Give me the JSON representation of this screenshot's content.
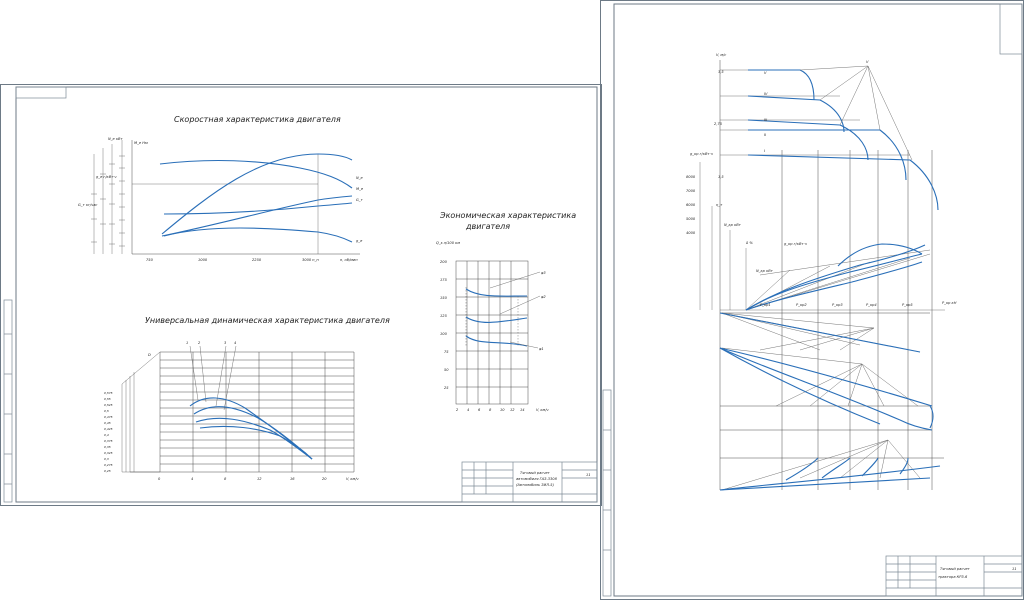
{
  "sheet1": {
    "speed_chart": {
      "title": "Скоростная характеристика двигателя",
      "axis_labels": [
        "N_e кВт",
        "M_e Нм",
        "g_e г/кВт·ч",
        "G_т кг/час",
        "n, об/мин"
      ],
      "x_ticks": [
        "750",
        "1000",
        "2250",
        "3000 n_н",
        "3750"
      ],
      "series_labels": [
        "N_e",
        "M_e",
        "G_т",
        "g_e"
      ]
    },
    "economic_chart": {
      "title_line1": "Экономическая характеристика",
      "title_line2": "двигателя",
      "y_label": "Q_s л/100 км",
      "y_ticks": [
        "200",
        "175",
        "150",
        "125",
        "100",
        "75",
        "50",
        "25"
      ],
      "x_ticks": [
        "2",
        "4",
        "6",
        "8",
        "10",
        "12",
        "14"
      ],
      "x_label": "V, км/ч",
      "series_labels": [
        "φ3",
        "φ2",
        "φ1"
      ]
    },
    "dynamic_chart": {
      "title": "Универсальная динамическая характеристика двигателя",
      "y_label": "D",
      "y_ticks": [
        "0,575",
        "0,55",
        "0,525",
        "0,5",
        "0,475",
        "0,45",
        "0,425",
        "0,4",
        "0,375",
        "0,35",
        "0,325",
        "0,3",
        "0,275",
        "0,25"
      ],
      "x_ticks": [
        "0",
        "4",
        "8",
        "12",
        "16",
        "20"
      ],
      "x_label": "V, км/ч",
      "gear_labels": [
        "1",
        "2",
        "3",
        "4"
      ]
    },
    "title_block": {
      "line1": "Тяговый расчет",
      "line2": "автомобиля ГАЗ-3308",
      "line3": "(Автомобиль ЗИЛ-5)",
      "sheet_no": "11"
    }
  },
  "sheet2": {
    "y_axis": "V, м/с",
    "speed_ticks": [
      "3,5",
      "2,75",
      "1,5"
    ],
    "gear_labels": [
      "V",
      "IV",
      "III",
      "II",
      "I"
    ],
    "axis_labels": [
      "g_кр г/кВт·ч",
      "η_т",
      "N_кр кВт",
      "δ %",
      "P_кр кН",
      "P_кр1",
      "P_кр2",
      "P_кр3",
      "P_кр4",
      "P_кр5"
    ],
    "g_ticks": [
      "8000",
      "7000",
      "6000",
      "5000",
      "4000"
    ],
    "title_block": {
      "line1": "Тяговый расчет",
      "line2": "трактора КРЗ-6",
      "sheet_no": "11"
    }
  },
  "colors": {
    "curve": "#2a6fb8",
    "frame": "#6d7a86",
    "grid": "#3b3b3b"
  }
}
